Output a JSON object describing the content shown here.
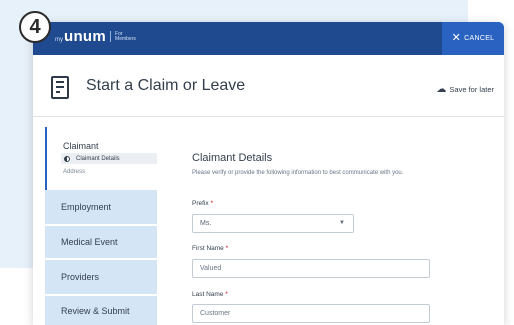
{
  "step": {
    "number": "4"
  },
  "topbar": {
    "logo_my": "my",
    "logo_brand": "unum",
    "logo_for": "For",
    "logo_members": "Members",
    "cancel_label": "CANCEL",
    "cancel_icon": "close-icon",
    "color": "#1f4a8f",
    "cancel_color": "#2a62c2"
  },
  "header": {
    "title": "Start a Claim or Leave",
    "save_label": "Save for later",
    "save_icon": "cloud-icon",
    "doc_icon": "document-icon"
  },
  "sidebar": {
    "active_label": "Claimant",
    "sub_items": [
      {
        "label": "Claimant Details",
        "icon": "half-circle-icon"
      },
      {
        "label": "Address"
      }
    ],
    "items": [
      {
        "label": "Employment"
      },
      {
        "label": "Medical Event"
      },
      {
        "label": "Providers"
      },
      {
        "label": "Review & Submit"
      }
    ],
    "item_color": "#d4e5f5"
  },
  "form": {
    "title": "Claimant Details",
    "description": "Please verify or provide the following information to best communicate with you.",
    "prefix": {
      "label": "Prefix",
      "value": "Ms."
    },
    "first_name": {
      "label": "First Name",
      "value": "Valued"
    },
    "last_name": {
      "label": "Last Name",
      "value": "Customer"
    },
    "required_mark": "*"
  }
}
